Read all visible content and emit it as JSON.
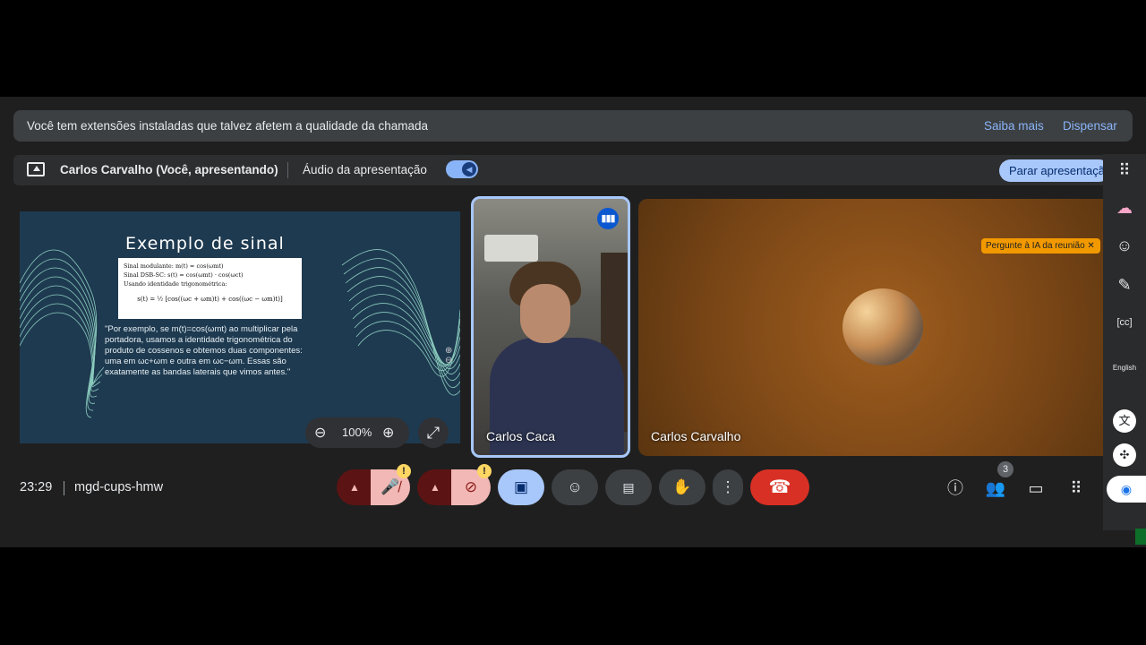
{
  "banner": {
    "message": "Você tem extensões instaladas que talvez afetem a qualidade da chamada",
    "learn_more": "Saiba mais",
    "dismiss": "Dispensar"
  },
  "presenting": {
    "presenter": "Carlos Carvalho (Você, apresentando)",
    "audio_label": "Áudio da apresentação",
    "audio_enabled": true,
    "stop_label": "Parar apresentação"
  },
  "slide": {
    "title": "Exemplo de sinal",
    "bullets": [
      "Sinal modulante: m(t) = cos(ωmt)",
      "Sinal DSB-SC: s(t) = cos(ωmt) · cos(ωct)",
      "Usando identidade trigonométrica:"
    ],
    "equation": "s(t) = ½ [cos((ωc + ωm)t) + cos((ωc − ωm)t)]",
    "quote": "\"Por exemplo, se m(t)=cos(ωmt) ao multiplicar pela portadora, usamos a identidade trigonométrica do produto de cossenos e obtemos duas componentes: uma em ωc+ωm e outra em ωc−ωm. Essas são exatamente as bandas laterais que vimos antes.\"",
    "zoom_level": "100%"
  },
  "participants": [
    {
      "name": "Carlos Caca",
      "speaking": true
    },
    {
      "name": "Carlos Carvalho",
      "speaking": false
    }
  ],
  "ai_badge": "Pergunte à IA da reunião",
  "right_rail": {
    "language_label": "English"
  },
  "meeting": {
    "time": "23:29",
    "code": "mgd-cups-hmw",
    "people_count": "3"
  },
  "colors": {
    "accent": "#a8c7fa",
    "end_call": "#d93025",
    "muted_bg": "#f2b8b5",
    "warning": "#fdd663",
    "ai_badge": "#f29900"
  }
}
